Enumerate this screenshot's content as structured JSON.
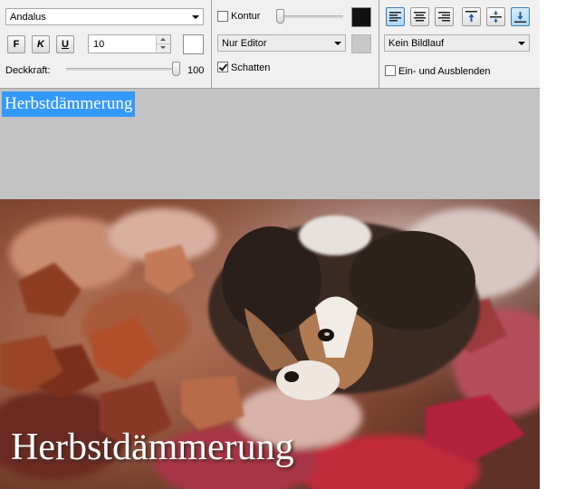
{
  "toolbar": {
    "font_select": {
      "value": "Andalus"
    },
    "format_buttons": {
      "bold": "F",
      "italic": "K",
      "underline": "U"
    },
    "font_size": {
      "value": "10"
    },
    "opacity": {
      "label": "Deckkraft:",
      "value": "100",
      "fraction": 1.0
    },
    "outline": {
      "label": "Kontur",
      "checked": false,
      "slider_fraction": 0.0,
      "color": "#111111"
    },
    "outline_mode_select": {
      "value": "Nur Editor"
    },
    "shadow": {
      "label": "Schatten",
      "checked": true
    },
    "alignment_buttons": [
      {
        "name": "align-left",
        "active": true
      },
      {
        "name": "align-center",
        "active": false
      },
      {
        "name": "align-right",
        "active": false
      },
      {
        "name": "valign-top",
        "active": false
      },
      {
        "name": "valign-middle",
        "active": false
      },
      {
        "name": "valign-bottom",
        "active": true
      }
    ],
    "scroll_select": {
      "value": "Kein Bildlauf"
    },
    "fade": {
      "label": "Ein- und Ausblenden",
      "checked": false
    }
  },
  "editor": {
    "text": "Herbstdämmerung",
    "background_color": "#c3c3c3",
    "selection_color": "#3399ff"
  },
  "photo": {
    "overlay_text": "Herbstdämmerung"
  }
}
